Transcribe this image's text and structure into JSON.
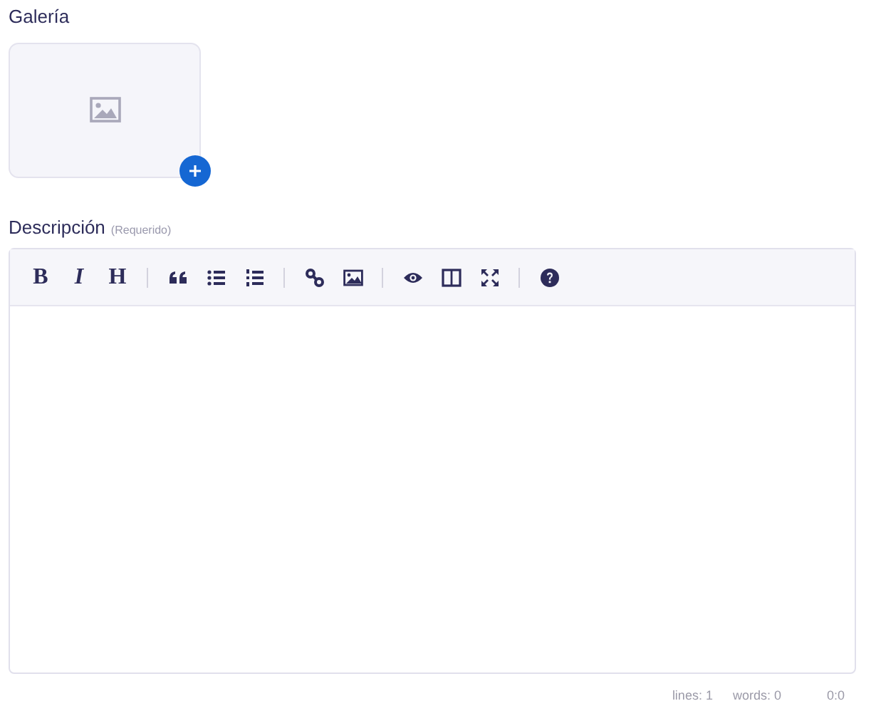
{
  "gallery": {
    "label": "Galería"
  },
  "description": {
    "label": "Descripción",
    "hint": "(Requerido)"
  },
  "toolbar": [
    [
      {
        "kind": "text",
        "label": "B"
      },
      {
        "kind": "text",
        "label": "I"
      },
      {
        "kind": "text",
        "label": "H"
      }
    ],
    [
      {
        "kind": "icon"
      },
      {
        "kind": "icon"
      },
      {
        "kind": "icon"
      }
    ],
    [
      {
        "kind": "icon"
      },
      {
        "kind": "icon"
      }
    ],
    [
      {
        "kind": "icon"
      },
      {
        "kind": "icon"
      },
      {
        "kind": "icon"
      }
    ],
    [
      {
        "kind": "icon"
      }
    ]
  ],
  "status_bar": [
    "lines: 1",
    "words: 0",
    "0:0"
  ]
}
